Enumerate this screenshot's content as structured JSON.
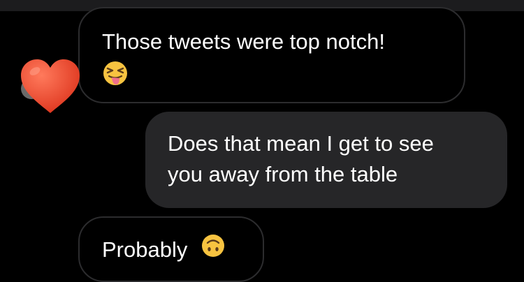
{
  "messages": [
    {
      "id": "msg1",
      "sender": "them",
      "text": "Those tweets were top notch!",
      "emoji": "squinting-face-with-tongue-icon",
      "reaction": "red-heart-icon"
    },
    {
      "id": "msg2",
      "sender": "me",
      "line1": "Does that mean I get to see",
      "line2": "you away from the table"
    },
    {
      "id": "msg3",
      "sender": "them",
      "text": "Probably",
      "emoji": "upside-down-face-icon"
    }
  ],
  "colors": {
    "background": "#000000",
    "incoming_border": "#2c2c2e",
    "outgoing_bubble": "#262628",
    "text": "#ffffff",
    "heart": "#e8432e",
    "emoji_yellow": "#f7c340"
  }
}
